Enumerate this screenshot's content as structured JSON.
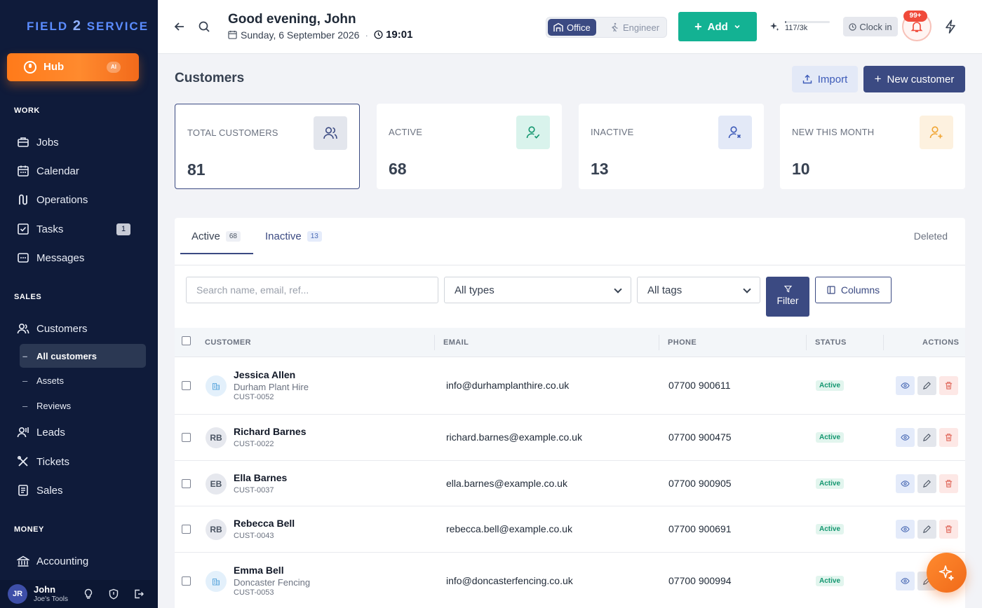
{
  "brand": {
    "logo_part1": "FIELD",
    "logo_part2": "2",
    "logo_part3": "SERVICE"
  },
  "sidebar": {
    "hub": {
      "label": "Hub",
      "badge": "AI"
    },
    "sections": {
      "work": "WORK",
      "sales": "SALES",
      "money": "MONEY"
    },
    "work_items": [
      {
        "label": "Jobs",
        "icon": "briefcase-icon"
      },
      {
        "label": "Calendar",
        "icon": "calendar-icon"
      },
      {
        "label": "Operations",
        "icon": "route-icon"
      },
      {
        "label": "Tasks",
        "icon": "checkbox-icon",
        "badge": "1"
      },
      {
        "label": "Messages",
        "icon": "message-icon"
      }
    ],
    "sales_items": [
      {
        "label": "Customers",
        "icon": "users-icon"
      },
      {
        "label": "Leads",
        "icon": "lead-icon"
      },
      {
        "label": "Tickets",
        "icon": "tools-icon"
      },
      {
        "label": "Sales",
        "icon": "receipt-icon"
      }
    ],
    "customers_sub": [
      "All customers",
      "Assets",
      "Reviews"
    ],
    "money_items": [
      {
        "label": "Accounting",
        "icon": "bank-icon"
      }
    ],
    "user": {
      "initials": "JR",
      "name": "John",
      "org": "Joe's Tools"
    }
  },
  "topbar": {
    "greeting": "Good evening, John",
    "date": "Sunday, 6 September 2026",
    "separator": "·",
    "time": "19:01",
    "mode_office": "Office",
    "mode_engineer": "Engineer",
    "add_label": "Add",
    "credits": "117/3k",
    "credits_fraction": 0.039,
    "clock_in": "Clock in",
    "notifications_badge": "99+"
  },
  "page": {
    "title": "Customers",
    "import_label": "Import",
    "new_label": "New customer"
  },
  "stats": [
    {
      "label": "TOTAL CUSTOMERS",
      "value": "81",
      "icon": "users-icon",
      "color": "#e3e6ed"
    },
    {
      "label": "ACTIVE",
      "value": "68",
      "icon": "user-check-icon",
      "color": "#d9f3ec"
    },
    {
      "label": "INACTIVE",
      "value": "13",
      "icon": "user-x-icon",
      "color": "#e3e9f7"
    },
    {
      "label": "NEW THIS MONTH",
      "value": "10",
      "icon": "user-plus-icon",
      "color": "#fdf1df"
    }
  ],
  "tabs": [
    {
      "label": "Active",
      "count": "68"
    },
    {
      "label": "Inactive",
      "count": "13"
    }
  ],
  "deleted_label": "Deleted",
  "filters": {
    "search_placeholder": "Search name, email, ref...",
    "types": "All types",
    "tags": "All tags",
    "filter_label": "Filter",
    "columns_label": "Columns"
  },
  "table": {
    "headers": [
      "CUSTOMER",
      "EMAIL",
      "PHONE",
      "STATUS",
      "ACTIONS"
    ],
    "rows": [
      {
        "avatar": "",
        "business": true,
        "name": "Jessica Allen",
        "company": "Durham Plant Hire",
        "ref": "CUST-0052",
        "email": "info@durhamplanthire.co.uk",
        "phone": "07700 900611",
        "status": "Active"
      },
      {
        "avatar": "RB",
        "business": false,
        "name": "Richard Barnes",
        "company": "",
        "ref": "CUST-0022",
        "email": "richard.barnes@example.co.uk",
        "phone": "07700 900475",
        "status": "Active"
      },
      {
        "avatar": "EB",
        "business": false,
        "name": "Ella Barnes",
        "company": "",
        "ref": "CUST-0037",
        "email": "ella.barnes@example.co.uk",
        "phone": "07700 900905",
        "status": "Active"
      },
      {
        "avatar": "RB",
        "business": false,
        "name": "Rebecca Bell",
        "company": "",
        "ref": "CUST-0043",
        "email": "rebecca.bell@example.co.uk",
        "phone": "07700 900691",
        "status": "Active"
      },
      {
        "avatar": "",
        "business": true,
        "name": "Emma Bell",
        "company": "Doncaster Fencing",
        "ref": "CUST-0053",
        "email": "info@doncasterfencing.co.uk",
        "phone": "07700 900994",
        "status": "Active"
      }
    ]
  }
}
